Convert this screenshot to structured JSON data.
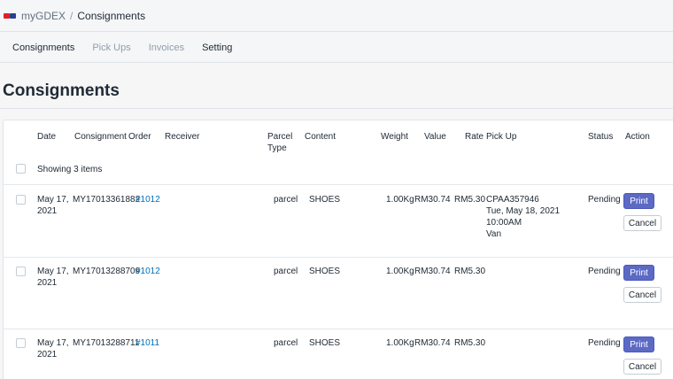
{
  "header": {
    "app_name": "myGDEX",
    "separator": "/",
    "page": "Consignments"
  },
  "nav": {
    "tabs": [
      {
        "label": "Consignments"
      },
      {
        "label": "Pick Ups"
      },
      {
        "label": "Invoices"
      },
      {
        "label": "Setting"
      }
    ]
  },
  "page_title": "Consignments",
  "table": {
    "columns": {
      "date": "Date",
      "consignment": "Consignment",
      "order": "Order",
      "receiver": "Receiver",
      "parcel_type_1": "Parcel",
      "parcel_type_2": "Type",
      "content": "Content",
      "weight": "Weight",
      "value": "Value",
      "rate": "Rate",
      "pickup": "Pick Up",
      "status": "Status",
      "action": "Action"
    },
    "showing": "Showing 3 items",
    "rows": [
      {
        "date_1": "May 17,",
        "date_2": "2021",
        "consignment": "MY17013361882",
        "order": "#1012",
        "receiver": "",
        "parcel_type": "parcel",
        "content": "SHOES",
        "weight": "1.00Kg",
        "value": "RM30.74",
        "rate": "RM5.30",
        "pickup_1": "CPAA357946",
        "pickup_2": "Tue, May 18, 2021",
        "pickup_3": "10:00AM",
        "pickup_4": "Van",
        "status": "Pending",
        "print_label": "Print",
        "cancel_label": "Cancel"
      },
      {
        "date_1": "May 17,",
        "date_2": "2021",
        "consignment": "MY17013288709",
        "order": "#1012",
        "receiver": "",
        "parcel_type": "parcel",
        "content": "SHOES",
        "weight": "1.00Kg",
        "value": "RM30.74",
        "rate": "RM5.30",
        "status": "Pending",
        "print_label": "Print",
        "cancel_label": "Cancel"
      },
      {
        "date_1": "May 17,",
        "date_2": "2021",
        "consignment": "MY17013288711",
        "order": "#1011",
        "receiver": "",
        "parcel_type": "parcel",
        "content": "SHOES",
        "weight": "1.00Kg",
        "value": "RM30.74",
        "rate": "RM5.30",
        "status": "Pending",
        "print_label": "Print",
        "cancel_label": "Cancel"
      }
    ]
  },
  "colors": {
    "primary_button": "#5c6ac4",
    "link": "#006fbb",
    "logo_red": "#e01f26",
    "logo_blue": "#2a3f8f"
  }
}
